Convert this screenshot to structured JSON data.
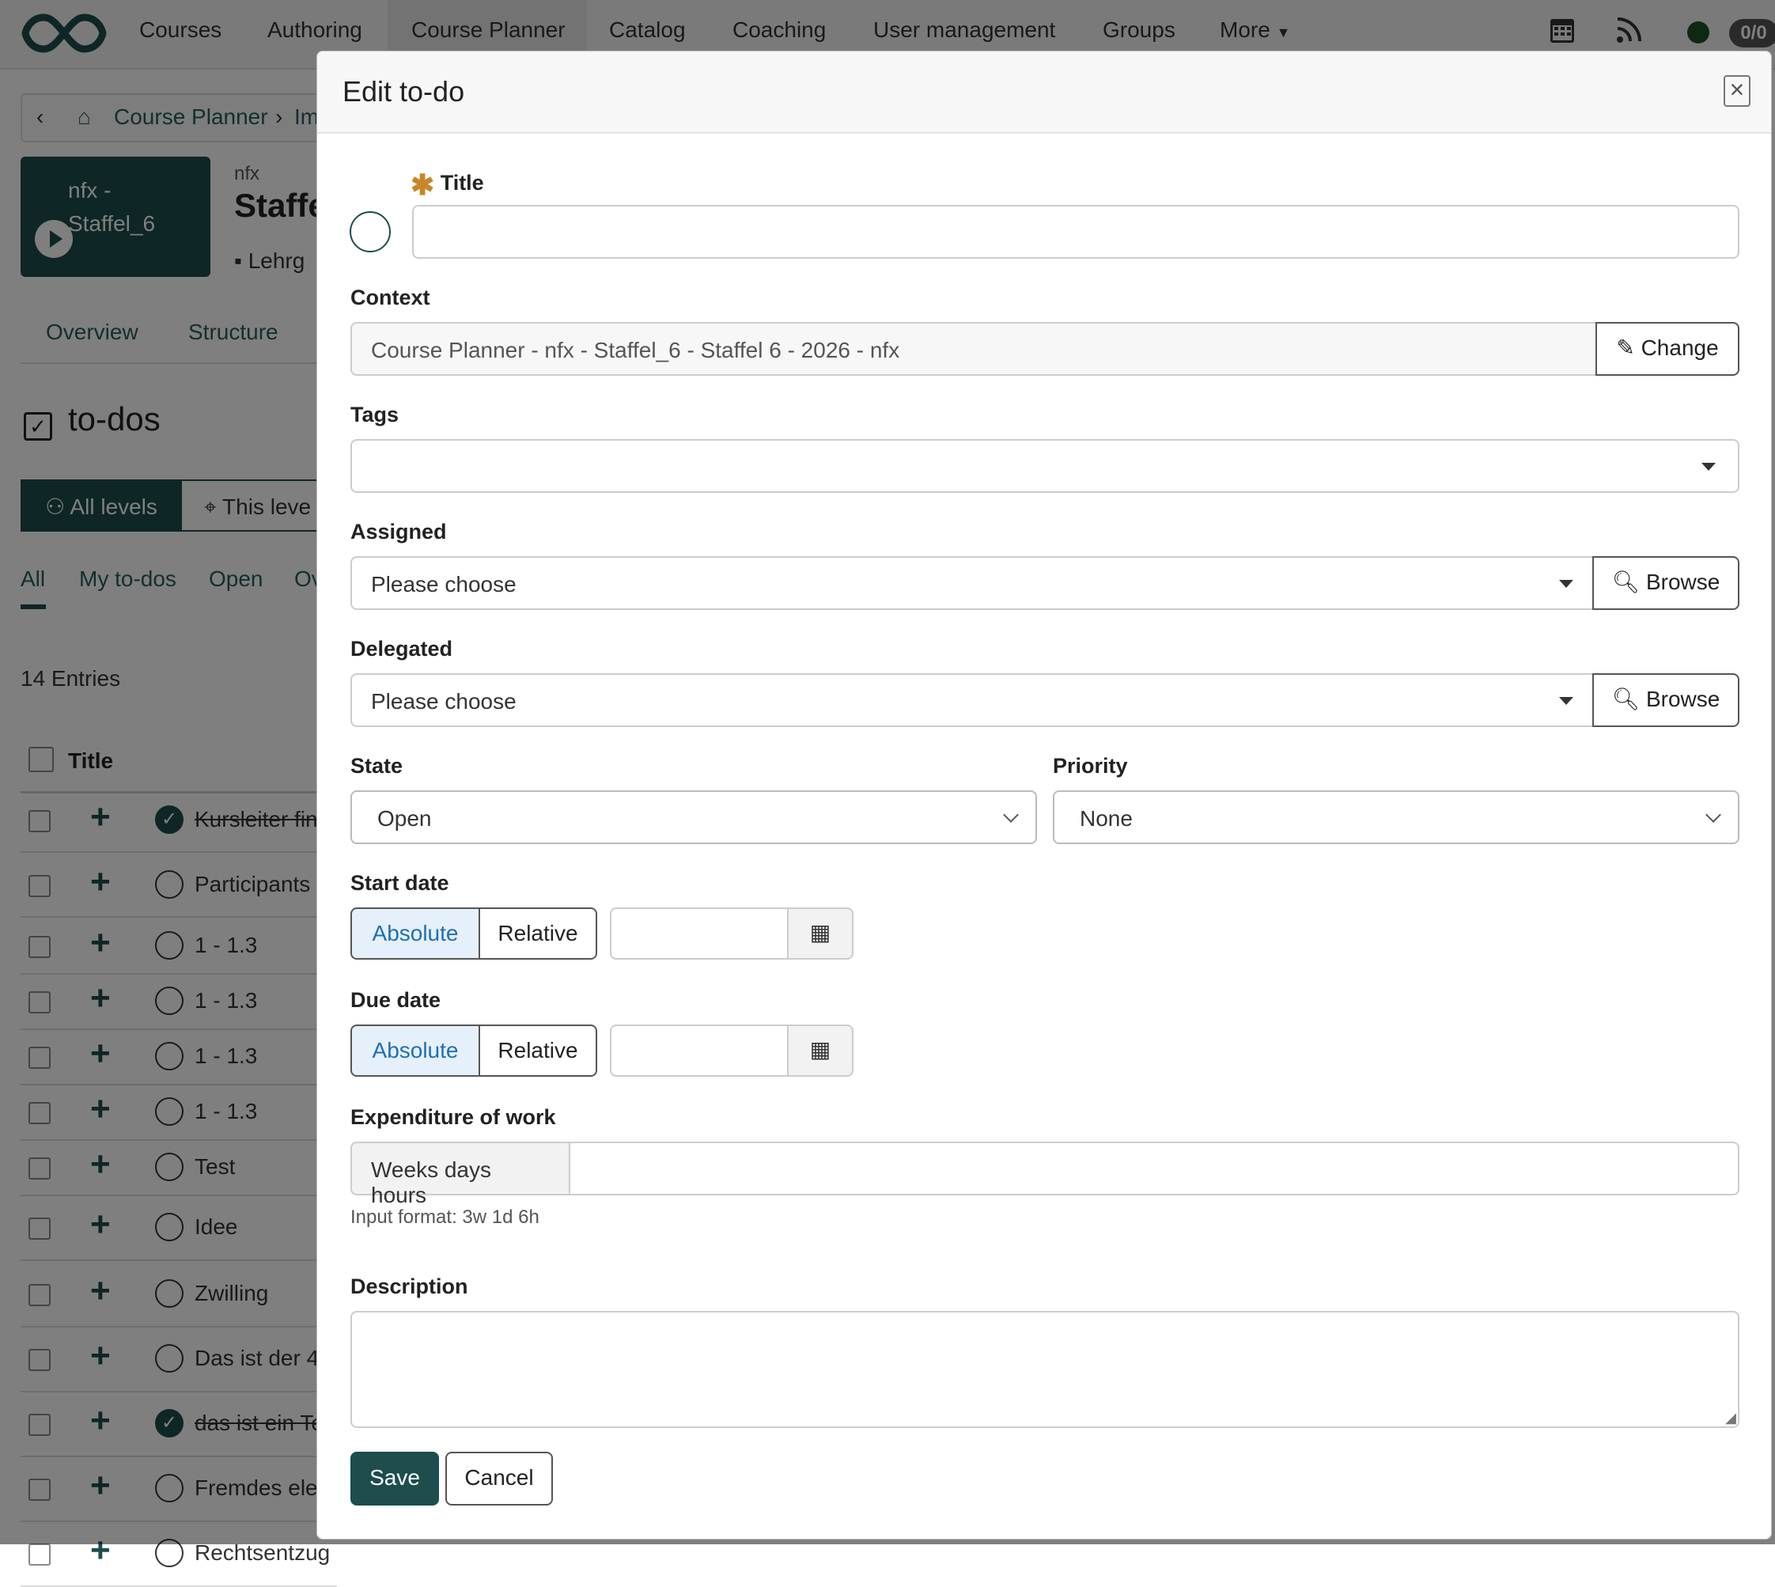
{
  "background": {
    "nav": [
      "Courses",
      "Authoring",
      "Course Planner",
      "Catalog",
      "Coaching",
      "User management",
      "Groups",
      "More"
    ],
    "badge": "0/0",
    "status_color": "#1f4f2a",
    "breadcrumb": {
      "home": "Course Planner",
      "next": "Im"
    },
    "course": {
      "tile_name": "nfx - Staffel_6",
      "kicker": "nfx",
      "title": "Staffe",
      "meta": "Lehrg"
    },
    "tabs": [
      "Overview",
      "Structure"
    ],
    "section_title": "to-dos",
    "scope": {
      "all": "All levels",
      "this": "This leve"
    },
    "filters": [
      "All",
      "My to-dos",
      "Open",
      "Ov"
    ],
    "entries": "14 Entries",
    "table_header": "Title",
    "rows": [
      {
        "text": "Kursleiter fin",
        "done": true
      },
      {
        "text": "Participants",
        "done": false
      },
      {
        "text": "1 - 1.3",
        "done": false
      },
      {
        "text": "1 - 1.3",
        "done": false
      },
      {
        "text": "1 - 1.3",
        "done": false
      },
      {
        "text": "1 - 1.3",
        "done": false
      },
      {
        "text": "Test",
        "done": false
      },
      {
        "text": "Idee",
        "done": false
      },
      {
        "text": "Zwilling",
        "done": false
      },
      {
        "text": "Das ist der 4",
        "done": false
      },
      {
        "text": "das ist ein Te",
        "done": true
      },
      {
        "text": "Fremdes ele",
        "done": false
      },
      {
        "text": "Rechtsentzug",
        "done": false
      }
    ]
  },
  "modal": {
    "title": "Edit to-do",
    "fields": {
      "title_label": "Title",
      "title_value": "",
      "context_label": "Context",
      "context_value": "Course Planner - nfx - Staffel_6 - Staffel 6 - 2026 - nfx",
      "change_label": "Change",
      "tags_label": "Tags",
      "assigned_label": "Assigned",
      "assigned_value": "Please choose",
      "delegated_label": "Delegated",
      "delegated_value": "Please choose",
      "browse_label": "Browse",
      "state_label": "State",
      "state_value": "Open",
      "priority_label": "Priority",
      "priority_value": "None",
      "start_date_label": "Start date",
      "due_date_label": "Due date",
      "absolute": "Absolute",
      "relative": "Relative",
      "work_label": "Expenditure of work",
      "work_addon": "Weeks days hours",
      "work_help": "Input format: 3w 1d 6h",
      "description_label": "Description"
    },
    "buttons": {
      "save": "Save",
      "cancel": "Cancel"
    }
  },
  "colors": {
    "brand": "#1d4d4d",
    "required": "#c8862a",
    "toggle_active": "#1d6fb8"
  }
}
